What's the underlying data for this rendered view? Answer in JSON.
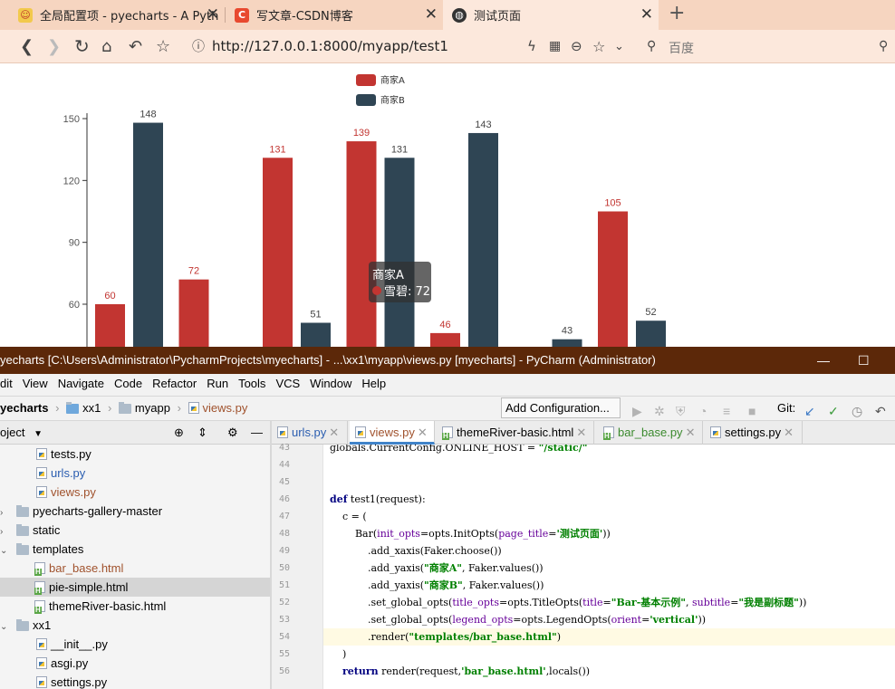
{
  "browser": {
    "tabs": [
      {
        "label": "全局配置项 - pyecharts - A Pyth",
        "icon": "pyecharts-icon"
      },
      {
        "label": "写文章-CSDN博客",
        "icon": "csdn-icon"
      },
      {
        "label": "测试页面",
        "icon": "globe-icon"
      }
    ],
    "url": "http://127.0.0.1:8000/myapp/test1",
    "search_placeholder": "百度"
  },
  "chart_data": {
    "type": "bar",
    "categories": [
      "",
      "",
      "",
      "",
      "",
      "",
      ""
    ],
    "series": [
      {
        "name": "商家A",
        "color": "#c23531",
        "values": [
          60,
          72,
          131,
          139,
          46,
          null,
          105
        ]
      },
      {
        "name": "商家B",
        "color": "#2f4554",
        "values": [
          148,
          null,
          51,
          131,
          143,
          43,
          52
        ]
      }
    ],
    "yticks": [
      60,
      90,
      120,
      150
    ],
    "ylim": [
      0,
      150
    ],
    "tooltip": {
      "series": "商家A",
      "label": "雪碧",
      "value": 72
    }
  },
  "ide": {
    "title": "yecharts [C:\\Users\\Administrator\\PycharmProjects\\myecharts] - ...\\xx1\\myapp\\views.py [myecharts] - PyCharm (Administrator)",
    "menu": [
      "dit",
      "View",
      "Navigate",
      "Code",
      "Refactor",
      "Run",
      "Tools",
      "VCS",
      "Window",
      "Help"
    ],
    "breadcrumb": [
      "yecharts",
      "xx1",
      "myapp",
      "views.py"
    ],
    "add_config": "Add Configuration...",
    "git_label": "Git:",
    "project_label": "oject",
    "tree": [
      {
        "label": "tests.py",
        "type": "py",
        "indent": 40
      },
      {
        "label": "urls.py",
        "type": "py",
        "indent": 40,
        "color": "#2a5db0"
      },
      {
        "label": "views.py",
        "type": "py",
        "indent": 40,
        "color": "#a0522d"
      },
      {
        "label": "pyecharts-gallery-master",
        "type": "dir",
        "indent": 0,
        "arrow": "›"
      },
      {
        "label": "static",
        "type": "dir",
        "indent": 0,
        "arrow": "›"
      },
      {
        "label": "templates",
        "type": "dir",
        "indent": 0,
        "arrow": "⌄"
      },
      {
        "label": "bar_base.html",
        "type": "html",
        "indent": 38,
        "color": "#a0522d"
      },
      {
        "label": "pie-simple.html",
        "type": "html",
        "indent": 38,
        "selected": true
      },
      {
        "label": "themeRiver-basic.html",
        "type": "html",
        "indent": 38
      },
      {
        "label": "xx1",
        "type": "dir",
        "indent": 0,
        "arrow": "⌄"
      },
      {
        "label": "__init__.py",
        "type": "py",
        "indent": 40
      },
      {
        "label": "asgi.py",
        "type": "py",
        "indent": 40
      },
      {
        "label": "settings.py",
        "type": "py",
        "indent": 40
      }
    ],
    "editor_tabs": [
      {
        "label": "urls.py",
        "color": "#2a5db0"
      },
      {
        "label": "views.py",
        "color": "#a0522d",
        "active": true
      },
      {
        "label": "themeRiver-basic.html",
        "color": "#000"
      },
      {
        "label": "bar_base.py",
        "color": "#3b8a2e"
      },
      {
        "label": "settings.py",
        "color": "#000"
      }
    ],
    "code": [
      {
        "n": "43",
        "text": "globals.CurrentConfig.ONLINE_HOST = \"/static/\""
      },
      {
        "n": "44",
        "text": ""
      },
      {
        "n": "45",
        "text": ""
      },
      {
        "n": "46",
        "text": "def test1(request):"
      },
      {
        "n": "47",
        "text": "    c = ("
      },
      {
        "n": "48",
        "text": "        Bar(init_opts=opts.InitOpts(page_title='测试页面'))"
      },
      {
        "n": "49",
        "text": "            .add_xaxis(Faker.choose())"
      },
      {
        "n": "50",
        "text": "            .add_yaxis(\"商家A\", Faker.values())"
      },
      {
        "n": "51",
        "text": "            .add_yaxis(\"商家B\", Faker.values())"
      },
      {
        "n": "52",
        "text": "            .set_global_opts(title_opts=opts.TitleOpts(title=\"Bar-基本示例\", subtitle=\"我是副标题\"))"
      },
      {
        "n": "53",
        "text": "            .set_global_opts(legend_opts=opts.LegendOpts(orient='vertical'))"
      },
      {
        "n": "54",
        "text": "            .render(\"templates/bar_base.html\")"
      },
      {
        "n": "55",
        "text": "    )"
      },
      {
        "n": "56",
        "text": "    return render(request,'bar_base.html',locals())"
      }
    ]
  }
}
